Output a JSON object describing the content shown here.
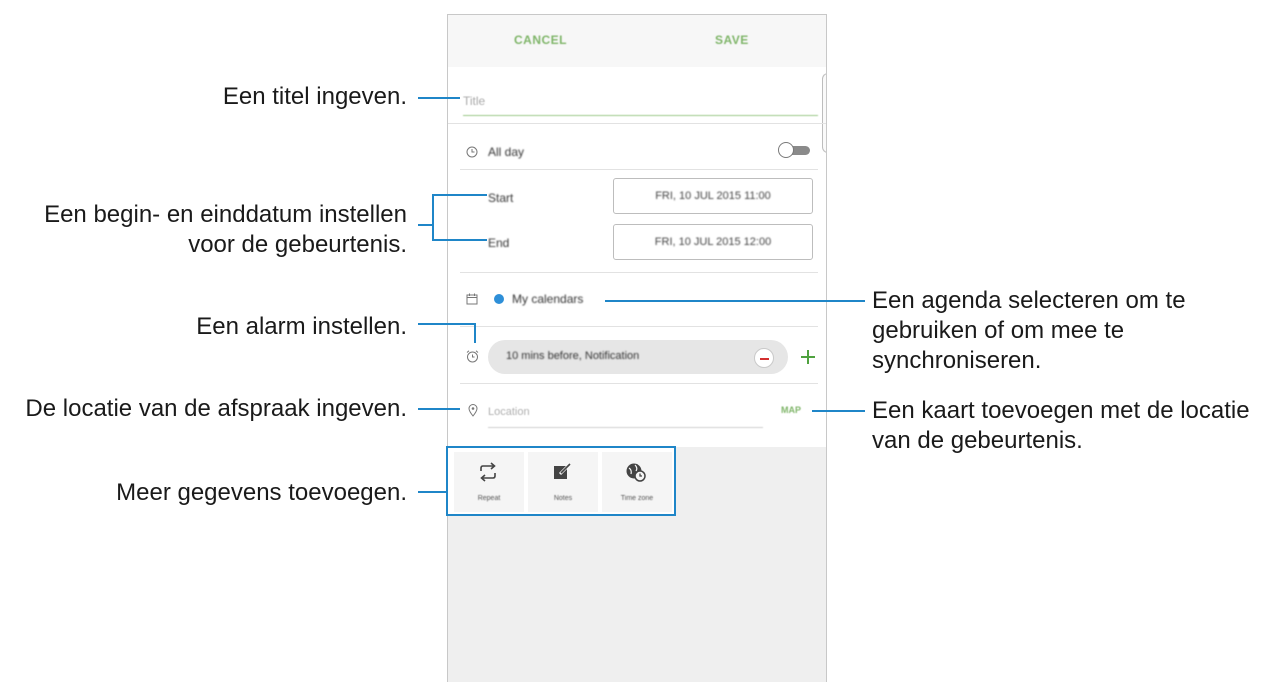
{
  "app": {
    "header": {
      "cancel_label": "CANCEL",
      "save_label": "SAVE"
    },
    "title_field": {
      "placeholder": "Title",
      "value": ""
    },
    "all_day": {
      "label": "All day",
      "toggle_on": false
    },
    "start": {
      "label": "Start",
      "value": "FRI, 10 JUL 2015   11:00"
    },
    "end": {
      "label": "End",
      "value": "FRI, 10 JUL 2015   12:00"
    },
    "calendar": {
      "label": "My calendars",
      "dot_color": "#2e8fd8"
    },
    "alarm": {
      "value": "10 mins before, Notification"
    },
    "location": {
      "placeholder": "Location",
      "value": "",
      "map_label": "MAP"
    },
    "quick_actions": [
      {
        "label": "Repeat",
        "icon": "repeat-icon"
      },
      {
        "label": "Notes",
        "icon": "notes-icon"
      },
      {
        "label": "Time zone",
        "icon": "time-zone-icon"
      }
    ]
  },
  "callouts": {
    "title": [
      "Een titel ingeven."
    ],
    "dates": [
      "Een begin- en einddatum instellen",
      "voor de gebeurtenis."
    ],
    "alarm": [
      "Een alarm instellen."
    ],
    "location": [
      "De locatie van de afspraak ingeven."
    ],
    "more": [
      "Meer gegevens toevoegen."
    ],
    "calendar": [
      "Een agenda selecteren om te",
      "gebruiken of om mee te",
      "synchroniseren."
    ],
    "map": [
      "Een kaart toevoegen met de locatie",
      "van de gebeurtenis."
    ]
  },
  "colors": {
    "accent_green": "#7fb569",
    "callout_line": "#1f86c8",
    "alarm_minus": "#d32f2f",
    "alarm_plus": "#4fa23f"
  }
}
